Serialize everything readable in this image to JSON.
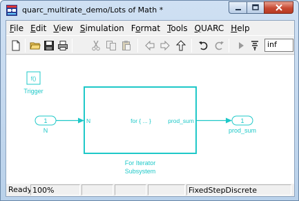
{
  "window": {
    "title": "quarc_multirate_demo/Lots of Math *",
    "minimize_label": "▁",
    "maximize_label": "☐",
    "close_label": "✕"
  },
  "menu": [
    {
      "label": "File",
      "accel": "F",
      "rest": "ile"
    },
    {
      "label": "Edit",
      "accel": "E",
      "rest": "dit"
    },
    {
      "label": "View",
      "accel": "V",
      "rest": "iew"
    },
    {
      "label": "Simulation",
      "accel": "S",
      "rest": "imulation"
    },
    {
      "label": "Format",
      "accel": "o",
      "pre": "F",
      "rest": "rmat"
    },
    {
      "label": "Tools",
      "accel": "T",
      "rest": "ools"
    },
    {
      "label": "QUARC",
      "accel": "Q",
      "rest": "UARC"
    },
    {
      "label": "Help",
      "accel": "H",
      "rest": "elp"
    }
  ],
  "toolbar": {
    "stop_time": "inf",
    "icons": [
      "new-file-icon",
      "open-folder-icon",
      "save-icon",
      "print-icon",
      "cut-icon",
      "copy-icon",
      "paste-icon",
      "back-arrow-icon",
      "forward-arrow-icon",
      "up-arrow-icon",
      "undo-icon",
      "redo-icon",
      "run-icon",
      "debug-icon"
    ]
  },
  "diagram": {
    "trigger_symbol": "f()",
    "trigger_label": "Trigger",
    "inport_number": "1",
    "inport_label": "N",
    "outport_number": "1",
    "outport_label": "prod_sum",
    "subsystem_in_port": "N",
    "subsystem_center": "for { ... }",
    "subsystem_out_port": "prod_sum",
    "subsystem_name_line1": "For Iterator",
    "subsystem_name_line2": "Subsystem",
    "colors": {
      "block": "#1ec8c8",
      "background": "#ffffff"
    }
  },
  "status": {
    "ready": "Ready",
    "zoom": "100%",
    "field3": "",
    "field4": "",
    "field5": "",
    "solver": "FixedStepDiscrete"
  }
}
